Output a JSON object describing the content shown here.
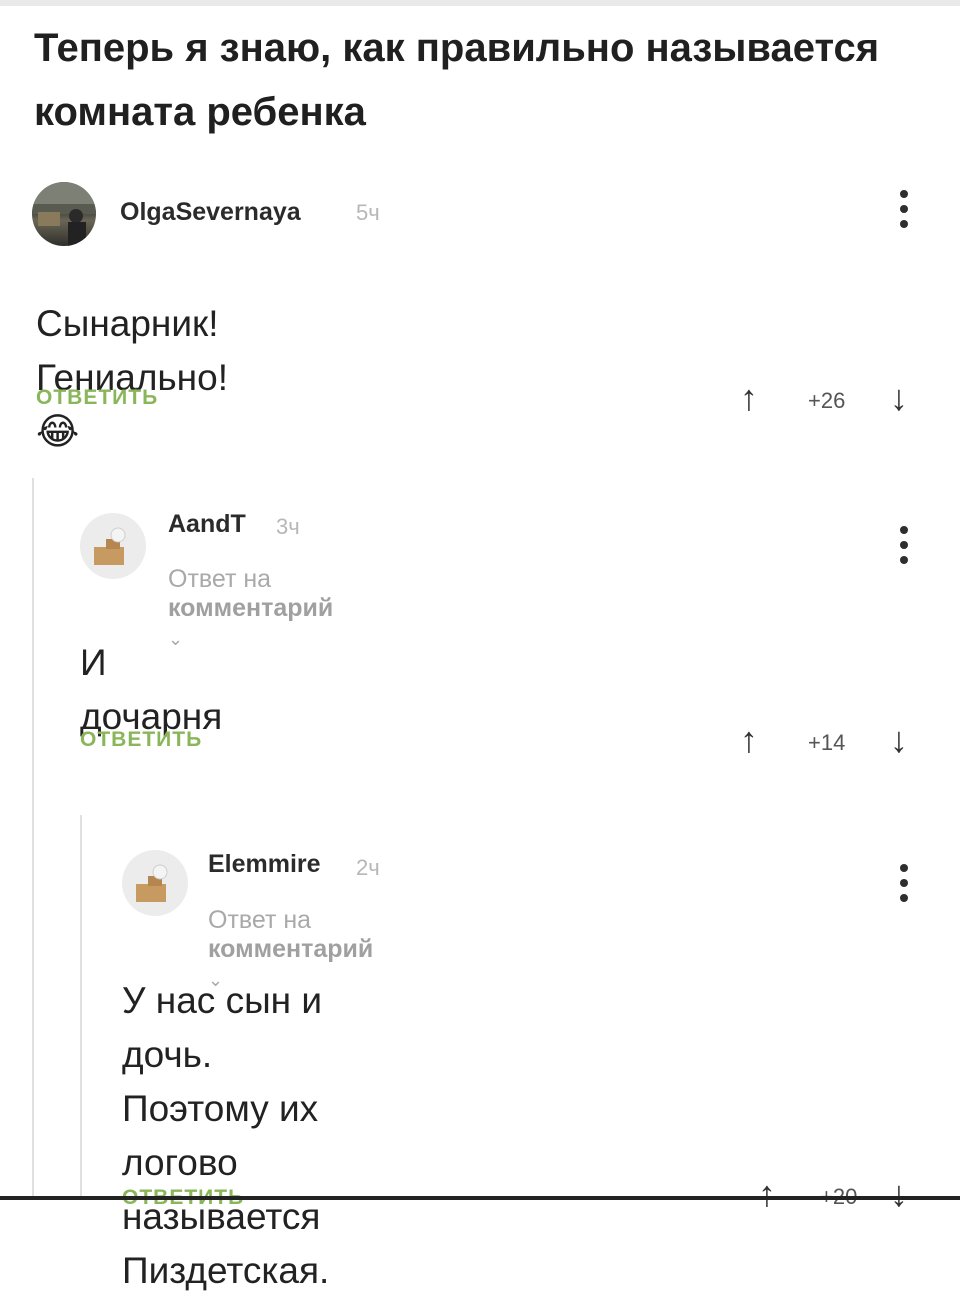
{
  "post": {
    "title": "Теперь я знаю, как правильно называется комната ребенка"
  },
  "comments": [
    {
      "username": "OlgaSevernaya",
      "time": "5ч",
      "text": "Сынарник! Гениально! 😂",
      "reply_label": "ОТВЕТИТЬ",
      "score": "+26"
    },
    {
      "username": "AandT",
      "time": "3ч",
      "reply_to_prefix": "Ответ на",
      "reply_to_target": "комментарий",
      "text": "И дочарня",
      "reply_label": "ОТВЕТИТЬ",
      "score": "+14"
    },
    {
      "username": "Elemmire",
      "time": "2ч",
      "reply_to_prefix": "Ответ на",
      "reply_to_target": "комментарий",
      "text_lines": [
        "У нас сын и дочь.",
        "Поэтому их логово называется",
        "Пиздетская."
      ],
      "reply_label": "ОТВЕТИТЬ",
      "score": "+20"
    }
  ],
  "icons": {
    "upvote": "arrow-up-icon",
    "downvote": "arrow-down-icon",
    "more": "more-vertical-icon",
    "expand": "chevron-down-icon"
  },
  "colors": {
    "reply_accent": "#8ab65a",
    "muted": "#a9a9a9"
  }
}
